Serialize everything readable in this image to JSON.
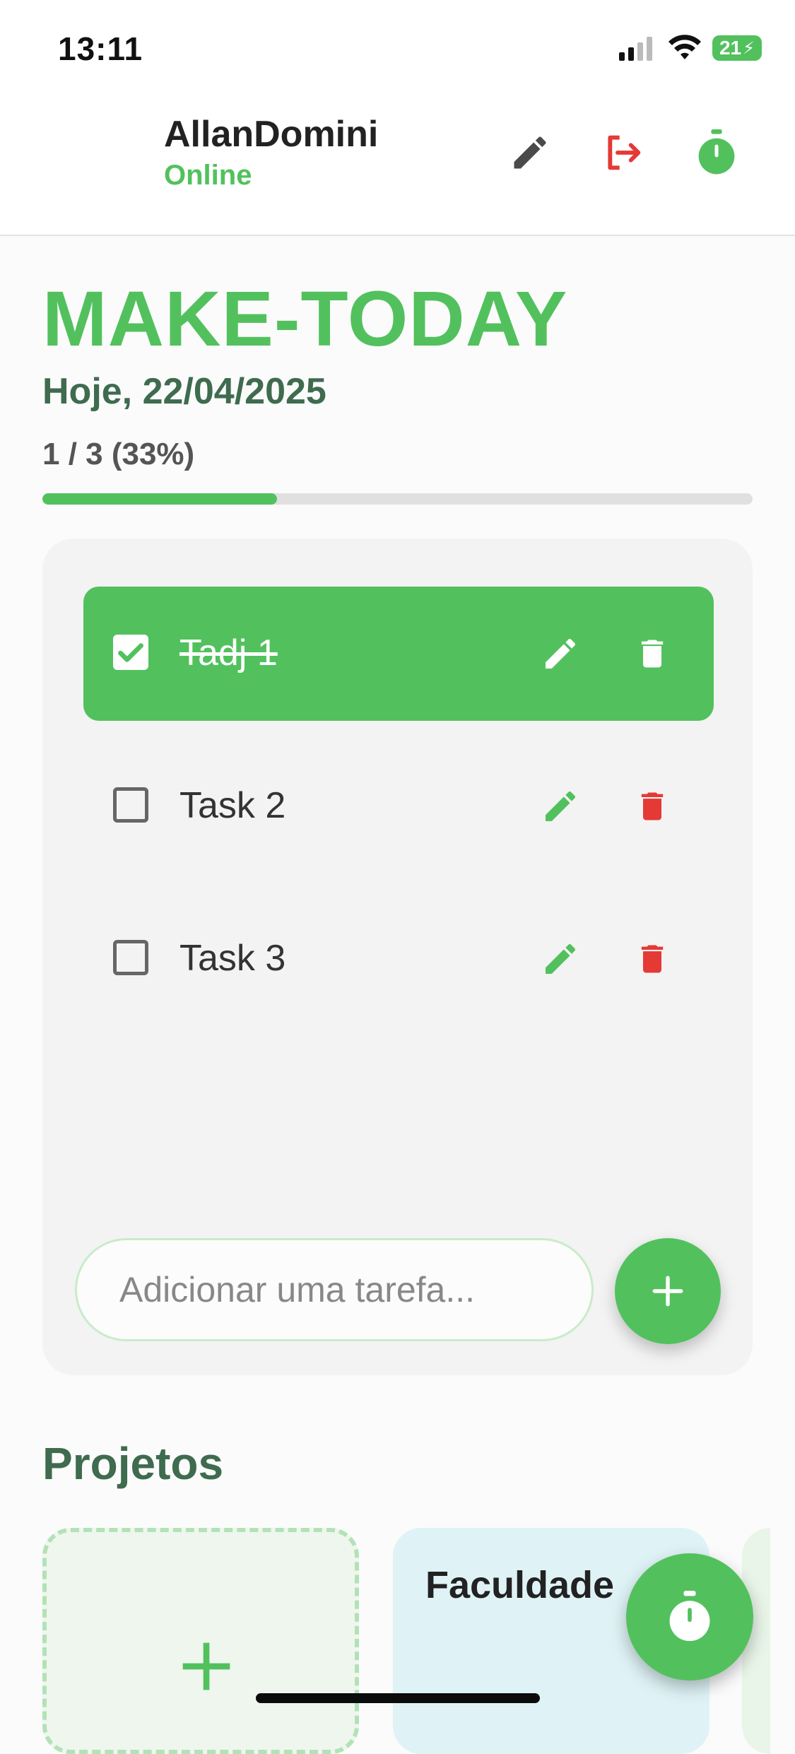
{
  "status_bar": {
    "time": "13:11",
    "battery": "21"
  },
  "header": {
    "username": "AllanDomini",
    "status": "Online",
    "icons": [
      "pencil-icon",
      "logout-icon",
      "stopwatch-icon"
    ]
  },
  "main": {
    "title": "MAKE-TODAY",
    "date": "Hoje, 22/04/2025",
    "progress_text": "1 / 3  (33%)",
    "progress_fraction": 0.33
  },
  "tasks": [
    {
      "label": "Tadj 1",
      "done": true
    },
    {
      "label": "Task 2",
      "done": false
    },
    {
      "label": "Task 3",
      "done": false
    }
  ],
  "add_task": {
    "placeholder": "Adicionar uma tarefa...",
    "icon": "plus-icon"
  },
  "projects": {
    "title": "Projetos",
    "items": [
      {
        "name": "Faculdade"
      }
    ],
    "add_icon": "plus-icon"
  },
  "fab": {
    "icon": "stopwatch-icon"
  },
  "colors": {
    "accent": "#52c15d",
    "danger": "#e53935",
    "dark_green": "#3f6b4f",
    "project_bg": "#dff3f6"
  }
}
